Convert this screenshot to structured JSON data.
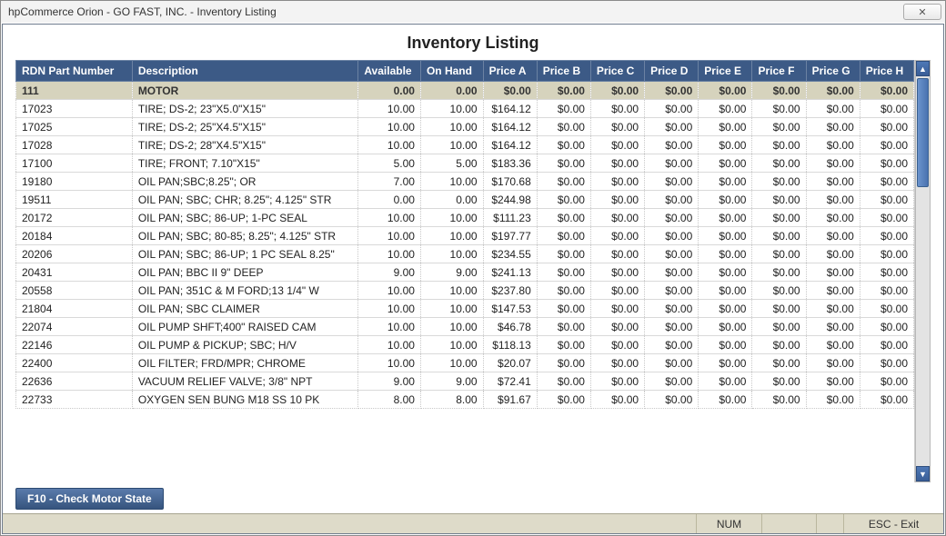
{
  "window": {
    "title": "hpCommerce Orion - GO FAST, INC. - Inventory Listing",
    "close_glyph": "✕"
  },
  "page": {
    "title": "Inventory Listing"
  },
  "columns": [
    "RDN Part Number",
    "Description",
    "Available",
    "On Hand",
    "Price A",
    "Price B",
    "Price C",
    "Price D",
    "Price E",
    "Price F",
    "Price G",
    "Price H"
  ],
  "rows": [
    {
      "selected": true,
      "part": "111",
      "desc": "MOTOR",
      "avail": "0.00",
      "onhand": "0.00",
      "pa": "$0.00",
      "pb": "$0.00",
      "pc": "$0.00",
      "pd": "$0.00",
      "pe": "$0.00",
      "pf": "$0.00",
      "pg": "$0.00",
      "ph": "$0.00"
    },
    {
      "selected": false,
      "part": "17023",
      "desc": "TIRE; DS-2; 23\"X5.0\"X15\"",
      "avail": "10.00",
      "onhand": "10.00",
      "pa": "$164.12",
      "pb": "$0.00",
      "pc": "$0.00",
      "pd": "$0.00",
      "pe": "$0.00",
      "pf": "$0.00",
      "pg": "$0.00",
      "ph": "$0.00"
    },
    {
      "selected": false,
      "part": "17025",
      "desc": "TIRE; DS-2; 25\"X4.5\"X15\"",
      "avail": "10.00",
      "onhand": "10.00",
      "pa": "$164.12",
      "pb": "$0.00",
      "pc": "$0.00",
      "pd": "$0.00",
      "pe": "$0.00",
      "pf": "$0.00",
      "pg": "$0.00",
      "ph": "$0.00"
    },
    {
      "selected": false,
      "part": "17028",
      "desc": "TIRE; DS-2; 28\"X4.5\"X15\"",
      "avail": "10.00",
      "onhand": "10.00",
      "pa": "$164.12",
      "pb": "$0.00",
      "pc": "$0.00",
      "pd": "$0.00",
      "pe": "$0.00",
      "pf": "$0.00",
      "pg": "$0.00",
      "ph": "$0.00"
    },
    {
      "selected": false,
      "part": "17100",
      "desc": "TIRE; FRONT; 7.10\"X15\"",
      "avail": "5.00",
      "onhand": "5.00",
      "pa": "$183.36",
      "pb": "$0.00",
      "pc": "$0.00",
      "pd": "$0.00",
      "pe": "$0.00",
      "pf": "$0.00",
      "pg": "$0.00",
      "ph": "$0.00"
    },
    {
      "selected": false,
      "part": "19180",
      "desc": "OIL PAN;SBC;8.25\"; OR",
      "avail": "7.00",
      "onhand": "10.00",
      "pa": "$170.68",
      "pb": "$0.00",
      "pc": "$0.00",
      "pd": "$0.00",
      "pe": "$0.00",
      "pf": "$0.00",
      "pg": "$0.00",
      "ph": "$0.00"
    },
    {
      "selected": false,
      "part": "19511",
      "desc": "OIL PAN; SBC; CHR; 8.25\"; 4.125\" STR",
      "avail": "0.00",
      "onhand": "0.00",
      "pa": "$244.98",
      "pb": "$0.00",
      "pc": "$0.00",
      "pd": "$0.00",
      "pe": "$0.00",
      "pf": "$0.00",
      "pg": "$0.00",
      "ph": "$0.00"
    },
    {
      "selected": false,
      "part": "20172",
      "desc": "OIL PAN; SBC; 86-UP; 1-PC SEAL",
      "avail": "10.00",
      "onhand": "10.00",
      "pa": "$111.23",
      "pb": "$0.00",
      "pc": "$0.00",
      "pd": "$0.00",
      "pe": "$0.00",
      "pf": "$0.00",
      "pg": "$0.00",
      "ph": "$0.00"
    },
    {
      "selected": false,
      "part": "20184",
      "desc": "OIL PAN; SBC; 80-85; 8.25\"; 4.125\" STR",
      "avail": "10.00",
      "onhand": "10.00",
      "pa": "$197.77",
      "pb": "$0.00",
      "pc": "$0.00",
      "pd": "$0.00",
      "pe": "$0.00",
      "pf": "$0.00",
      "pg": "$0.00",
      "ph": "$0.00"
    },
    {
      "selected": false,
      "part": "20206",
      "desc": "OIL PAN; SBC; 86-UP; 1 PC SEAL 8.25\"",
      "avail": "10.00",
      "onhand": "10.00",
      "pa": "$234.55",
      "pb": "$0.00",
      "pc": "$0.00",
      "pd": "$0.00",
      "pe": "$0.00",
      "pf": "$0.00",
      "pg": "$0.00",
      "ph": "$0.00"
    },
    {
      "selected": false,
      "part": "20431",
      "desc": "OIL PAN; BBC II 9\" DEEP",
      "avail": "9.00",
      "onhand": "9.00",
      "pa": "$241.13",
      "pb": "$0.00",
      "pc": "$0.00",
      "pd": "$0.00",
      "pe": "$0.00",
      "pf": "$0.00",
      "pg": "$0.00",
      "ph": "$0.00"
    },
    {
      "selected": false,
      "part": "20558",
      "desc": "OIL PAN; 351C & M FORD;13 1/4\" W",
      "avail": "10.00",
      "onhand": "10.00",
      "pa": "$237.80",
      "pb": "$0.00",
      "pc": "$0.00",
      "pd": "$0.00",
      "pe": "$0.00",
      "pf": "$0.00",
      "pg": "$0.00",
      "ph": "$0.00"
    },
    {
      "selected": false,
      "part": "21804",
      "desc": "OIL PAN; SBC CLAIMER",
      "avail": "10.00",
      "onhand": "10.00",
      "pa": "$147.53",
      "pb": "$0.00",
      "pc": "$0.00",
      "pd": "$0.00",
      "pe": "$0.00",
      "pf": "$0.00",
      "pg": "$0.00",
      "ph": "$0.00"
    },
    {
      "selected": false,
      "part": "22074",
      "desc": "OIL PUMP SHFT;400\" RAISED CAM",
      "avail": "10.00",
      "onhand": "10.00",
      "pa": "$46.78",
      "pb": "$0.00",
      "pc": "$0.00",
      "pd": "$0.00",
      "pe": "$0.00",
      "pf": "$0.00",
      "pg": "$0.00",
      "ph": "$0.00"
    },
    {
      "selected": false,
      "part": "22146",
      "desc": "OIL PUMP & PICKUP; SBC; H/V",
      "avail": "10.00",
      "onhand": "10.00",
      "pa": "$118.13",
      "pb": "$0.00",
      "pc": "$0.00",
      "pd": "$0.00",
      "pe": "$0.00",
      "pf": "$0.00",
      "pg": "$0.00",
      "ph": "$0.00"
    },
    {
      "selected": false,
      "part": "22400",
      "desc": "OIL FILTER; FRD/MPR; CHROME",
      "avail": "10.00",
      "onhand": "10.00",
      "pa": "$20.07",
      "pb": "$0.00",
      "pc": "$0.00",
      "pd": "$0.00",
      "pe": "$0.00",
      "pf": "$0.00",
      "pg": "$0.00",
      "ph": "$0.00"
    },
    {
      "selected": false,
      "part": "22636",
      "desc": "VACUUM RELIEF VALVE; 3/8\" NPT",
      "avail": "9.00",
      "onhand": "9.00",
      "pa": "$72.41",
      "pb": "$0.00",
      "pc": "$0.00",
      "pd": "$0.00",
      "pe": "$0.00",
      "pf": "$0.00",
      "pg": "$0.00",
      "ph": "$0.00"
    },
    {
      "selected": false,
      "part": "22733",
      "desc": "OXYGEN SEN BUNG M18 SS 10 PK",
      "avail": "8.00",
      "onhand": "8.00",
      "pa": "$91.67",
      "pb": "$0.00",
      "pc": "$0.00",
      "pd": "$0.00",
      "pe": "$0.00",
      "pf": "$0.00",
      "pg": "$0.00",
      "ph": "$0.00"
    }
  ],
  "buttons": {
    "check_motor": "F10 - Check Motor State"
  },
  "statusbar": {
    "num": "NUM",
    "esc": "ESC - Exit"
  },
  "scroll": {
    "up_glyph": "▲",
    "down_glyph": "▼"
  }
}
